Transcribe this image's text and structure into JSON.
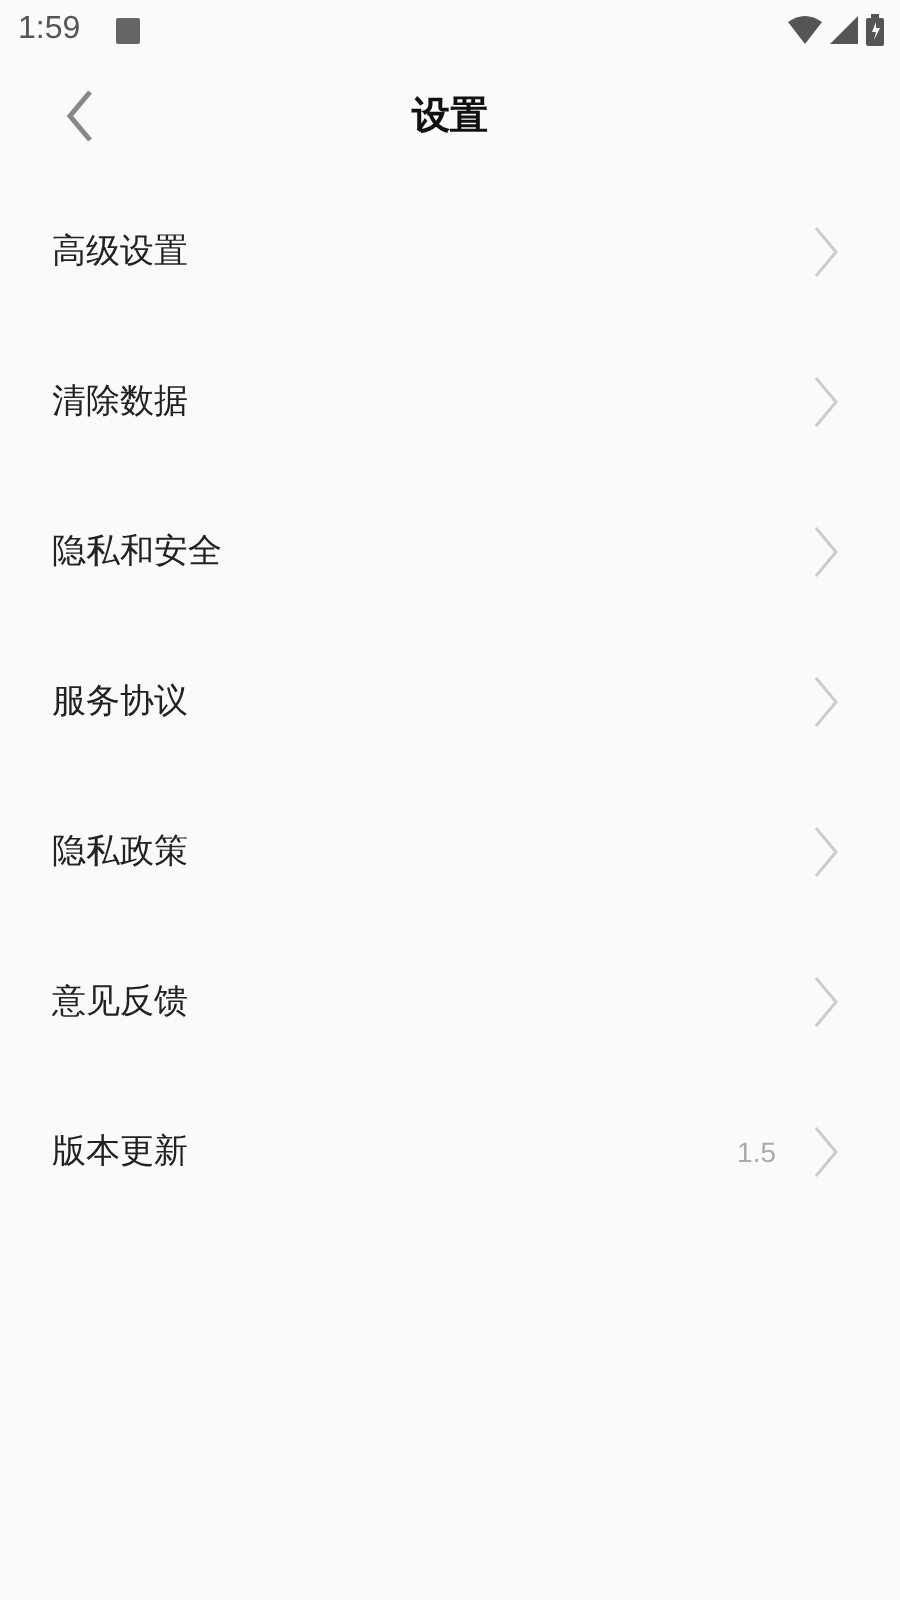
{
  "status_bar": {
    "time": "1:59"
  },
  "header": {
    "title": "设置"
  },
  "items": [
    {
      "label": "高级设置"
    },
    {
      "label": "清除数据"
    },
    {
      "label": "隐私和安全"
    },
    {
      "label": "服务协议"
    },
    {
      "label": "隐私政策"
    },
    {
      "label": "意见反馈"
    },
    {
      "label": "版本更新",
      "value": "1.5"
    }
  ]
}
